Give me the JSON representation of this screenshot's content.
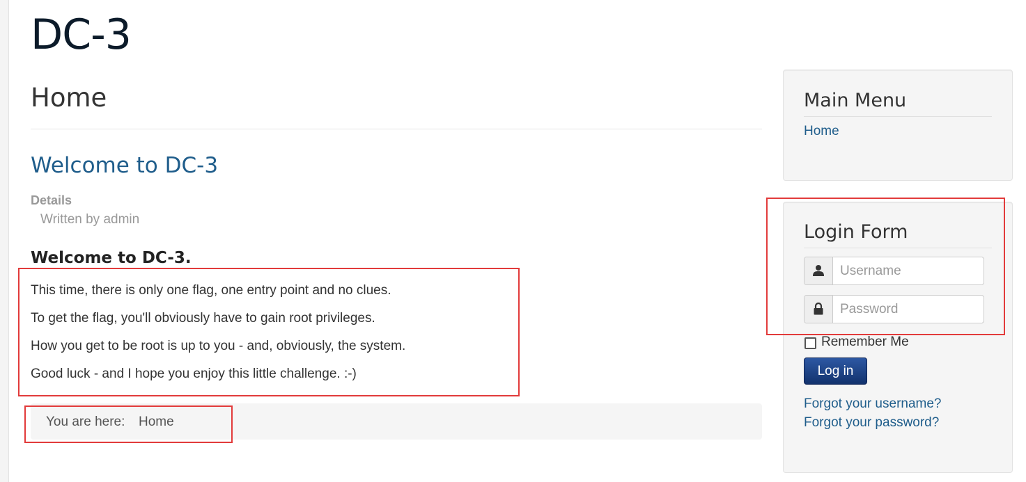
{
  "site": {
    "title": "DC-3"
  },
  "main": {
    "page_heading": "Home",
    "article": {
      "title": "Welcome to DC-3",
      "details_label": "Details",
      "written_by": "Written by admin",
      "subheading": "Welcome to DC-3.",
      "paragraphs": [
        "This time, there is only one flag, one entry point and no clues.",
        "To get the flag, you'll obviously have to gain root privileges.",
        "How you get to be root is up to you - and, obviously, the system.",
        "Good luck - and I hope you enjoy this little challenge.  :-)"
      ]
    },
    "breadcrumb": {
      "label": "You are here:",
      "current": "Home"
    }
  },
  "sidebar": {
    "main_menu": {
      "title": "Main Menu",
      "items": [
        {
          "label": "Home"
        }
      ]
    },
    "login_form": {
      "title": "Login Form",
      "username_placeholder": "Username",
      "password_placeholder": "Password",
      "username_icon": "user-icon",
      "password_icon": "lock-icon",
      "remember_label": "Remember Me",
      "login_button": "Log in",
      "forgot_username": "Forgot your username?",
      "forgot_password": "Forgot your password?"
    }
  },
  "colors": {
    "link": "#1f5d8b",
    "annotation_border": "#e23b3b",
    "button": "#12326d",
    "panel_bg": "#f5f5f5"
  }
}
